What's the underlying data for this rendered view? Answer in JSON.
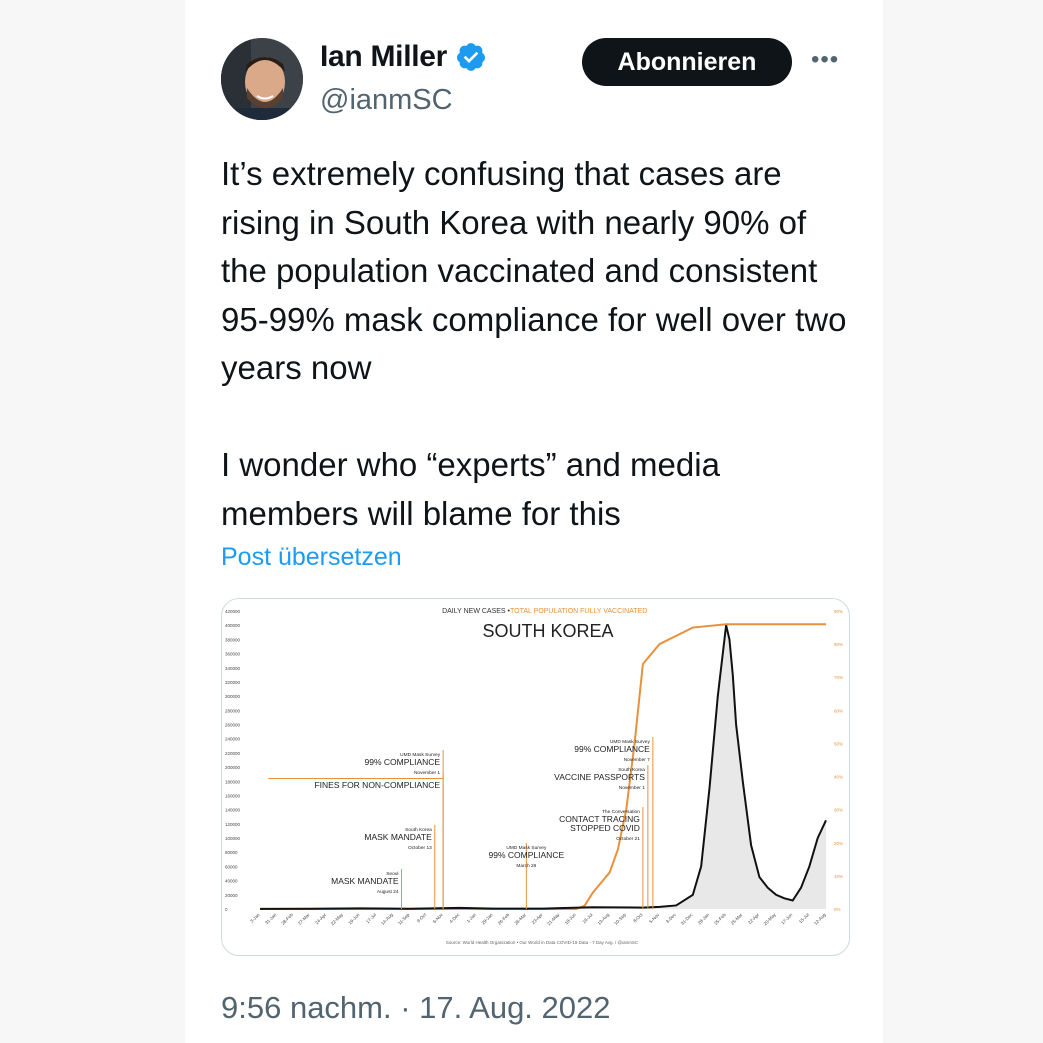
{
  "tweet": {
    "author_name": "Ian Miller",
    "handle": "@ianmSC",
    "follow_label": "Abonnieren",
    "more_label": "•••",
    "text": "It’s extremely confusing that cases are rising in South Korea with nearly 90% of the population vaccinated and consistent 95-99% mask compliance for well over two years now\n\nI wonder who “experts” and media members will blame for this",
    "translate_label": "Post übersetzen",
    "timestamp": "9:56 nachm. · 17. Aug. 2022"
  },
  "colors": {
    "verified": "#1d9bf0",
    "link": "#1d9bf0",
    "vaccination_line": "#e8913c",
    "cases_line": "#111111"
  },
  "icons": {
    "verified": "verified-badge-icon",
    "more": "more-icon"
  },
  "chart_data": {
    "type": "line",
    "title": "SOUTH KOREA",
    "subtitle_parts": [
      "DAILY NEW CASES • ",
      "TOTAL POPULATION FULLY VACCINATED"
    ],
    "source": "Source: World Health Organization • Our World in Data COVID-19 Data - 7 Day Avg. / @ianmSC",
    "y_left_ticks": [
      "0",
      "20000",
      "40000",
      "60000",
      "80000",
      "100000",
      "120000",
      "140000",
      "160000",
      "180000",
      "200000",
      "220000",
      "240000",
      "260000",
      "280000",
      "300000",
      "320000",
      "340000",
      "360000",
      "380000",
      "400000",
      "420000"
    ],
    "y_right_ticks": [
      "0%",
      "10%",
      "20%",
      "30%",
      "40%",
      "50%",
      "60%",
      "70%",
      "80%",
      "90%"
    ],
    "x_ticks": [
      "3-Jan",
      "31-Jan",
      "28-Feb",
      "27-Mar",
      "24-Apr",
      "22-May",
      "19-Jun",
      "17-Jul",
      "14-Aug",
      "11-Sep",
      "9-Oct",
      "6-Nov",
      "4-Dec",
      "1-Jan",
      "29-Jan",
      "26-Feb",
      "26-Mar",
      "23-Apr",
      "21-May",
      "18-Jun",
      "16-Jul",
      "13-Aug",
      "10-Sep",
      "8-Oct",
      "5-Nov",
      "3-Dec",
      "31-Dec",
      "28-Jan",
      "25-Feb",
      "25-Mar",
      "22-Apr",
      "20-May",
      "17-Jun",
      "15-Jul",
      "12-Aug"
    ],
    "ylim_left": [
      0,
      420000
    ],
    "ylim_right": [
      0,
      90
    ],
    "series": [
      {
        "name": "DAILY NEW CASES",
        "axis": "left",
        "x": [
          0,
          3,
          6,
          9,
          12,
          14,
          17,
          18,
          20,
          23,
          24,
          25,
          26,
          26.5,
          27,
          27.5,
          28,
          28.2,
          28.4,
          28.6,
          29,
          29.5,
          30,
          30.5,
          31,
          31.5,
          32,
          32.5,
          33,
          33.5,
          34
        ],
        "values": [
          200,
          300,
          800,
          400,
          1500,
          500,
          600,
          1200,
          2500,
          2000,
          3000,
          5000,
          20000,
          60000,
          170000,
          300000,
          400000,
          380000,
          330000,
          260000,
          180000,
          90000,
          45000,
          30000,
          20000,
          15000,
          12000,
          30000,
          60000,
          100000,
          125000
        ]
      },
      {
        "name": "TOTAL POPULATION FULLY VACCINATED",
        "axis": "right",
        "x": [
          0,
          19,
          19.5,
          20,
          20.5,
          21,
          21.5,
          22,
          22.5,
          23,
          24,
          26,
          28,
          34
        ],
        "values": [
          0,
          0,
          1,
          5,
          8,
          11,
          18,
          30,
          50,
          74,
          80,
          85,
          86,
          86
        ]
      }
    ],
    "annotations": [
      {
        "lines": [
          "Seoul",
          "MASK MANDATE",
          "August 24"
        ],
        "x": 8.5,
        "right": true
      },
      {
        "lines": [
          "South Korea",
          "MASK MANDATE",
          "October 13"
        ],
        "x": 10.5,
        "right": true
      },
      {
        "lines": [
          "UMD Mask Survey",
          "99% COMPLIANCE",
          "November 1"
        ],
        "x": 11,
        "right": true
      },
      {
        "lines": [
          "",
          "FINES FOR NON-COMPLIANCE",
          ""
        ],
        "x": 11,
        "right": true
      },
      {
        "lines": [
          "UMD Mask Survey",
          "99% COMPLIANCE",
          "March 26"
        ],
        "x": 16,
        "right": false
      },
      {
        "lines": [
          "The Conversation",
          "CONTACT TRACING",
          "STOPPED COVID",
          "October 21"
        ],
        "x": 23,
        "right": true
      },
      {
        "lines": [
          "South Korea",
          "VACCINE PASSPORTS",
          "November 1"
        ],
        "x": 23.3,
        "right": true
      },
      {
        "lines": [
          "UMD Mask Survey",
          "99% COMPLIANCE",
          "November 7"
        ],
        "x": 23.6,
        "right": true
      }
    ]
  }
}
